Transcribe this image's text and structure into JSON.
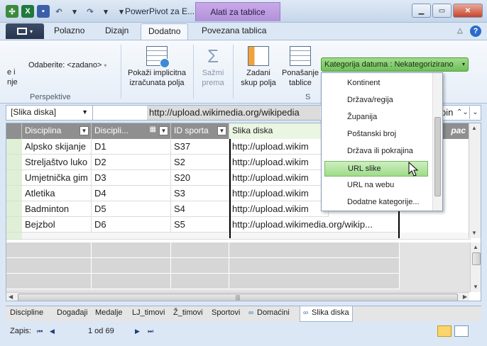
{
  "title_bar": {
    "window_title": "PowerPivot za E...",
    "context_tab": "Alati za tablice"
  },
  "ribbon_tabs": [
    "Polazno",
    "Dizajn",
    "Dodatno",
    "Povezana tablica"
  ],
  "ribbon": {
    "perspective_select": "Odaberite: <zadano>",
    "perspective_clip": "e i\nnje",
    "group_perspektive": "Perspektive",
    "group_clip": "S",
    "show_implicit": "Pokaži implicitna\nizračunata polja",
    "summarize": "Sažmi\nprema",
    "default_field_set": "Zadani\nskup polja",
    "table_behavior": "Ponašanje\ntablice",
    "data_category": "Kategorija datuma : Nekategorizirano"
  },
  "formula_bar": {
    "name_box": "[Slika diska]",
    "value": "http://upload.wikimedia.org/wikipedia",
    "tail": "pin"
  },
  "table": {
    "headers": [
      "Disciplina",
      "Discipli...",
      "ID sporta",
      "Slika diska",
      "pac"
    ],
    "rows": [
      [
        "Alpsko skijanje",
        "D1",
        "S37",
        "http://upload.wikim"
      ],
      [
        "Streljaštvo luko",
        "D2",
        "S2",
        "http://upload.wikim"
      ],
      [
        "Umjetnička gim",
        "D3",
        "S20",
        "http://upload.wikim"
      ],
      [
        "Atletika",
        "D4",
        "S3",
        "http://upload.wikim"
      ],
      [
        "Badminton",
        "D5",
        "S4",
        "http://upload.wikim"
      ],
      [
        "Bejzbol",
        "D6",
        "S5",
        "http://upload.wikimedia.org/wikip..."
      ]
    ]
  },
  "data_category_menu": {
    "items": [
      "Kontinent",
      "Država/regija",
      "Županija",
      "Poštanski broj",
      "Država ili pokrajina",
      "URL slike",
      "URL na webu",
      "Dodatne kategorije..."
    ],
    "highlighted": "URL slike"
  },
  "sheet_tabs": [
    "Discipline",
    "Događaji",
    "Medalje",
    "LJ_timovi",
    "Ž_timovi",
    "Sportovi",
    "Domaćini",
    "Slika diska"
  ],
  "status_bar": {
    "record_label": "Zapis:",
    "record_position": "1 od 69"
  },
  "colors": {
    "ribbon_bg": "#dce7f5",
    "context_tab": "#b292d8",
    "data_category_button": "#6ec05a",
    "table_header": "#8f8f8f",
    "selected_header": "#eaf5e2"
  }
}
